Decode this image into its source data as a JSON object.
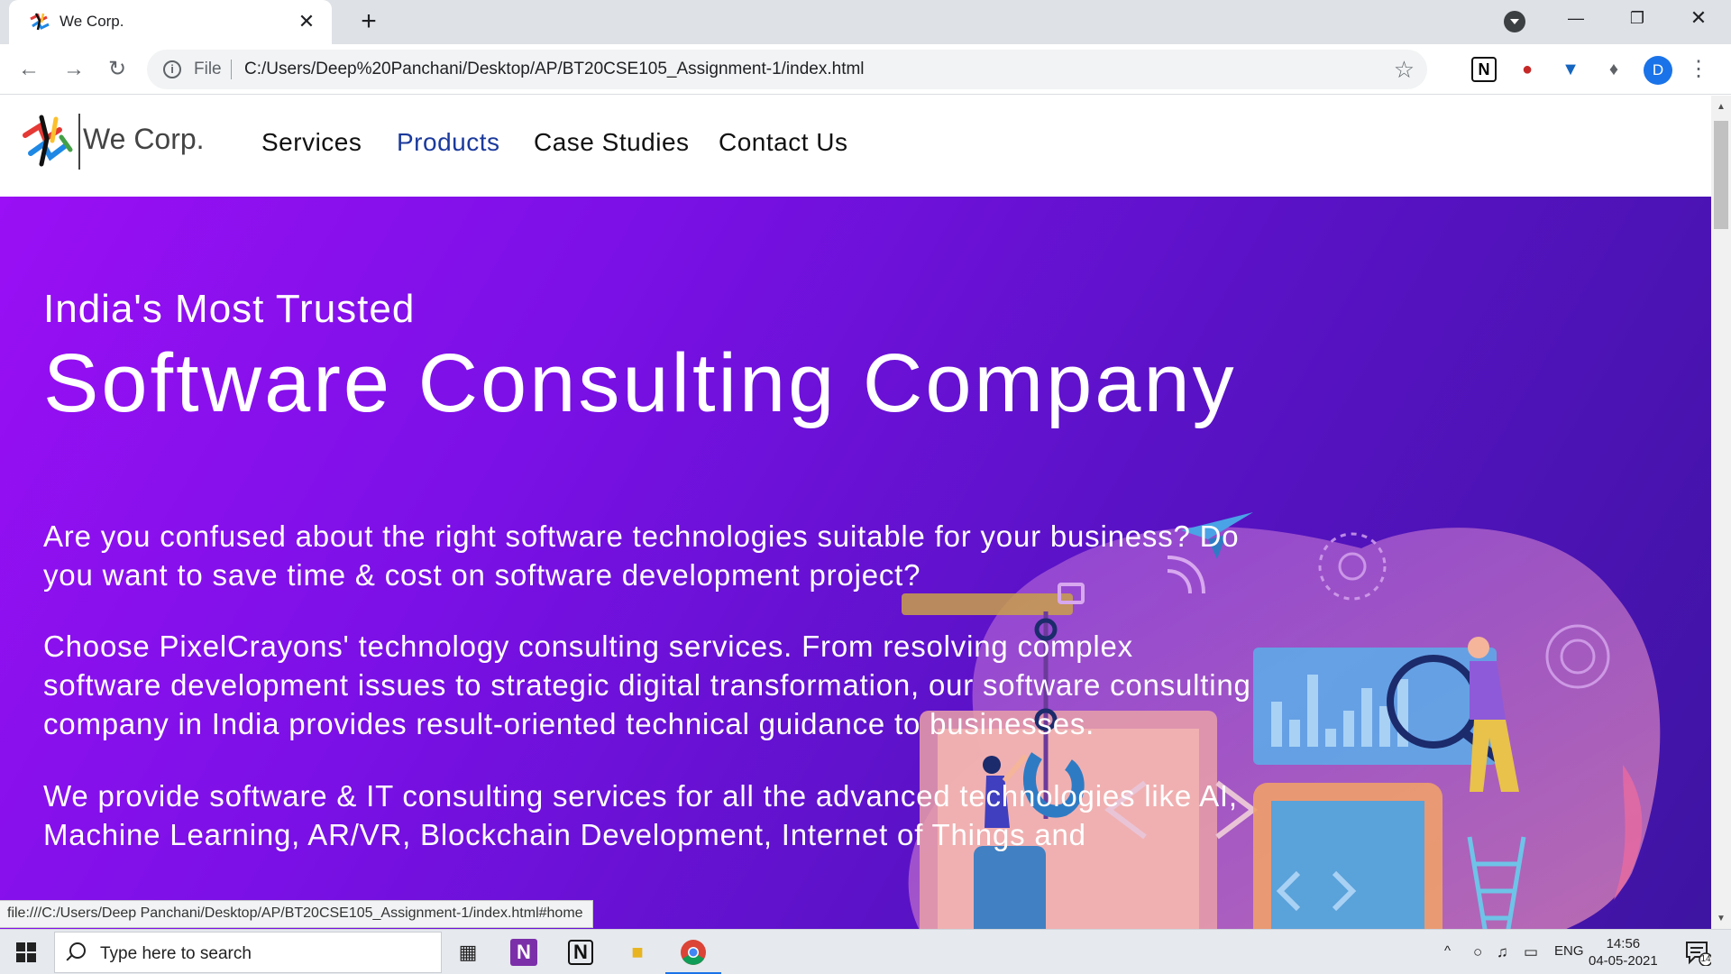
{
  "browser": {
    "tab_title": "We Corp.",
    "tab_close": "✕",
    "new_tab": "+",
    "scheme_label": "File",
    "url": "C:/Users/Deep%20Panchani/Desktop/AP/BT20CSE105_Assignment-1/index.html",
    "profile_initial": "D",
    "status_url": "file:///C:/Users/Deep Panchani/Desktop/AP/BT20CSE105_Assignment-1/index.html#home",
    "icons": {
      "back": "back-arrow-icon",
      "forward": "forward-arrow-icon",
      "reload": "reload-icon",
      "info": "info-icon",
      "bookmark": "star-icon",
      "extensions": "puzzle-icon",
      "menu": "kebab-menu-icon"
    }
  },
  "site": {
    "logo_text": "We Corp.",
    "nav": [
      {
        "label": "Services",
        "active": false
      },
      {
        "label": "Products",
        "active": true
      },
      {
        "label": "Case Studies",
        "active": false
      },
      {
        "label": "Contact Us",
        "active": false
      }
    ],
    "hero": {
      "kicker": "India's Most Trusted",
      "title": "Software Consulting Company",
      "paragraphs": [
        "Are you confused about the right software technologies suitable for your business? Do you want to save time & cost on software development project?",
        "Choose PixelCrayons' technology consulting services. From resolving complex software development issues to strategic digital transformation, our software consulting company in India provides result-oriented technical guidance to businesses.",
        "We provide software & IT consulting services for all the advanced technologies like AI, Machine Learning, AR/VR, Blockchain Development, Internet of Things and"
      ]
    },
    "colors": {
      "hero_gradient_start": "#9a0ff5",
      "hero_gradient_end": "#3c14a0",
      "active_nav": "#1b3a9c"
    }
  },
  "taskbar": {
    "search_placeholder": "Type here to search",
    "language": "ENG",
    "time": "14:56",
    "date": "04-05-2021",
    "notification_count": "14"
  }
}
